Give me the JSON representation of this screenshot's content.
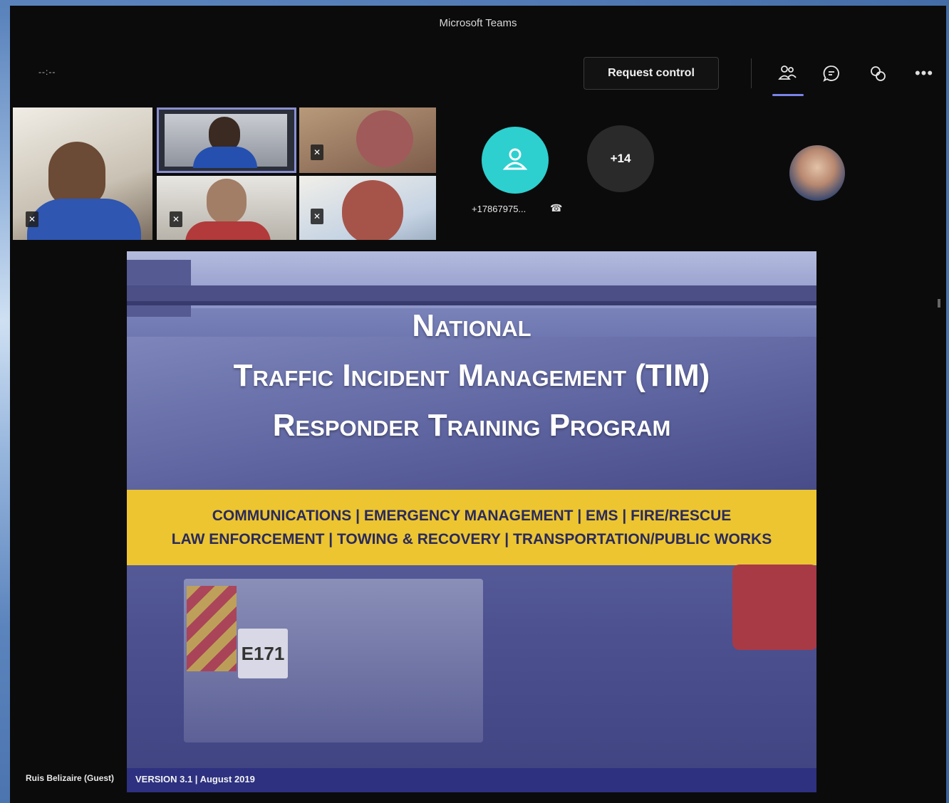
{
  "window": {
    "title": "Microsoft Teams"
  },
  "toolbar": {
    "timer": "--:--",
    "request_control_label": "Request control",
    "icons": [
      "people-icon",
      "chat-icon",
      "reactions-icon",
      "more-options-icon"
    ],
    "more_label": "•••"
  },
  "participants": {
    "phone_caller": "+17867975...",
    "overflow_count": "+14",
    "colors": {
      "phone_avatar": "#2ecfcf",
      "overflow_avatar": "#2a2a2a"
    }
  },
  "slide": {
    "title_line1": "National",
    "title_line2": "Traffic Incident Management (TIM)",
    "title_line3": "Responder Training Program",
    "band_row1": "COMMUNICATIONS | EMERGENCY MANAGEMENT | EMS | FIRE/RESCUE",
    "band_row2": "LAW ENFORCEMENT | TOWING & RECOVERY | TRANSPORTATION/PUBLIC WORKS",
    "truck_label": "E171",
    "version": "VERSION 3.1 | August 2019",
    "colors": {
      "band": "#ecc531",
      "band_text": "#2a2a5c",
      "footer": "#2d3180"
    }
  },
  "presenter": {
    "name": "Ruis Belizaire (Guest)"
  }
}
